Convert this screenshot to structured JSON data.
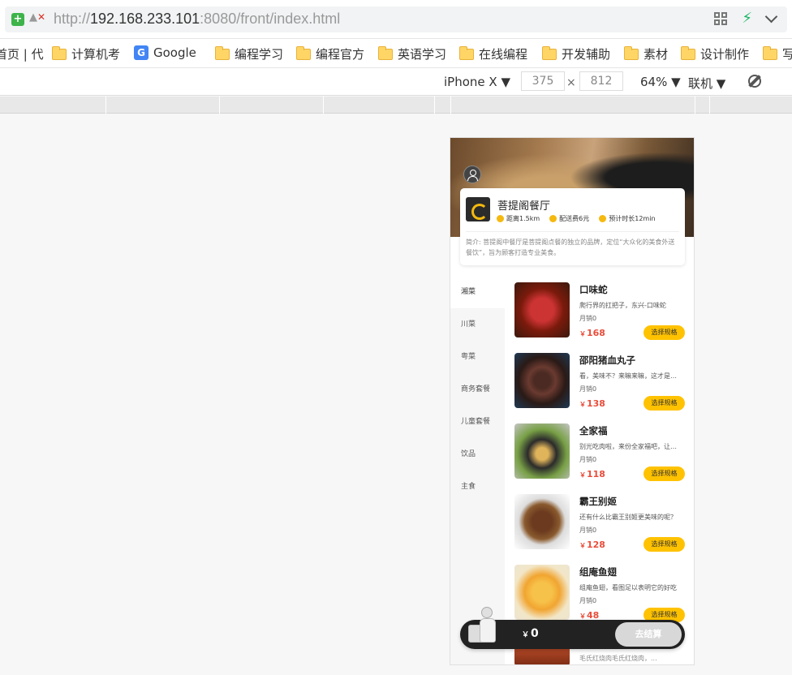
{
  "browser": {
    "url_prefix": "http://",
    "url_host": "192.168.233.101",
    "url_rest": ":8080/front/index.html",
    "bookmarks": [
      {
        "label": "首页 | 代",
        "icon": "none"
      },
      {
        "label": "计算机考",
        "icon": "folder-icon"
      },
      {
        "label": "Google",
        "icon": "google-icon"
      },
      {
        "label": "编程学习",
        "icon": "folder-icon"
      },
      {
        "label": "编程官方",
        "icon": "folder-icon"
      },
      {
        "label": "英语学习",
        "icon": "folder-icon"
      },
      {
        "label": "在线编程",
        "icon": "folder-icon"
      },
      {
        "label": "开发辅助",
        "icon": "folder-icon"
      },
      {
        "label": "素材",
        "icon": "folder-icon"
      },
      {
        "label": "设计制作",
        "icon": "folder-icon"
      },
      {
        "label": "写",
        "icon": "folder-icon"
      }
    ],
    "devtools": {
      "device": "iPhone X ▼",
      "width": "375",
      "x": "×",
      "height": "812",
      "zoom": "64% ▼",
      "network": "联机 ▼"
    }
  },
  "shop": {
    "name": "菩提阁餐厅",
    "distance": "距离1.5km",
    "delivery_fee": "配送费6元",
    "eta": "预计时长12min",
    "description": "简介: 菩提阁中餐厅是菩提阁点餐的独立的品牌，定位“大众化的美食外送餐饮”，旨为顾客打造专业美食。"
  },
  "categories": [
    "湘菜",
    "川菜",
    "粤菜",
    "商务套餐",
    "儿童套餐",
    "饮品",
    "主食"
  ],
  "active_category": "湘菜",
  "dishes": [
    {
      "name": "口味蛇",
      "desc": "爬行界的扛把子，东兴-口味蛇",
      "sales": "月销0",
      "currency": "￥",
      "price": "168",
      "button": "选择规格"
    },
    {
      "name": "邵阳猪血丸子",
      "desc": "看，美味不？来嘛来嘛，这才是最爱吖",
      "sales": "月销0",
      "currency": "￥",
      "price": "138",
      "button": "选择规格"
    },
    {
      "name": "全家福",
      "desc": "别光吃肉啦，来份全家福吧，让你长寿又美味",
      "sales": "月销0",
      "currency": "￥",
      "price": "118",
      "button": "选择规格"
    },
    {
      "name": "霸王别姬",
      "desc": "还有什么比霸王别姬更美味的呢？",
      "sales": "月销0",
      "currency": "￥",
      "price": "128",
      "button": "选择规格"
    },
    {
      "name": "组庵鱼翅",
      "desc": "组庵鱼翅，看图足以表明它的好吃",
      "sales": "月销0",
      "currency": "￥",
      "price": "48",
      "button": "选择规格"
    }
  ],
  "peek_dish_desc": "毛氏红烧肉毛氏红烧肉，...",
  "cart": {
    "currency": "￥",
    "total": "0",
    "checkout_label": "去结算"
  }
}
